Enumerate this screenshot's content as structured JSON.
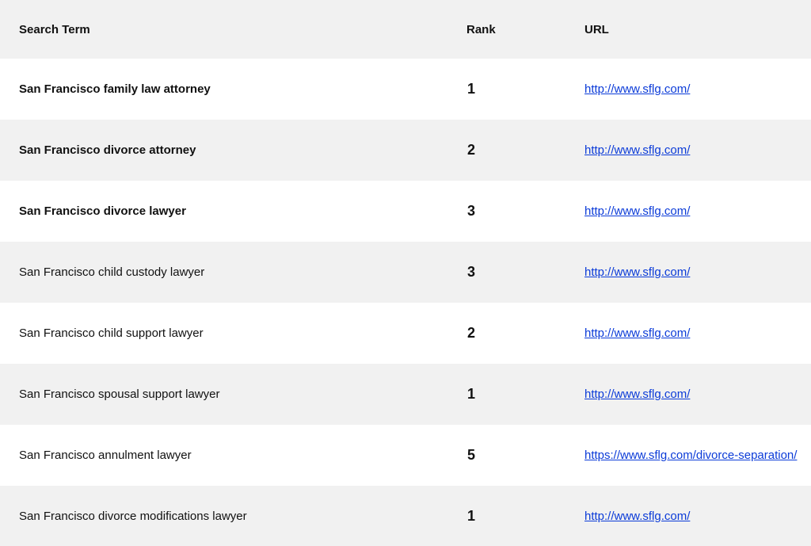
{
  "table": {
    "headers": {
      "search_term": "Search Term",
      "rank": "Rank",
      "url": "URL"
    },
    "rows": [
      {
        "term": "San Francisco family law attorney",
        "rank": "1",
        "url": "http://www.sflg.com/",
        "bold": true
      },
      {
        "term": "San Francisco divorce attorney",
        "rank": "2",
        "url": "http://www.sflg.com/",
        "bold": true
      },
      {
        "term": "San Francisco divorce lawyer",
        "rank": "3",
        "url": "http://www.sflg.com/",
        "bold": true
      },
      {
        "term": "San Francisco child custody lawyer",
        "rank": "3",
        "url": "http://www.sflg.com/",
        "bold": false
      },
      {
        "term": "San Francisco child support lawyer",
        "rank": "2",
        "url": "http://www.sflg.com/",
        "bold": false
      },
      {
        "term": "San Francisco spousal support lawyer",
        "rank": "1",
        "url": "http://www.sflg.com/",
        "bold": false
      },
      {
        "term": "San Francisco annulment lawyer",
        "rank": "5",
        "url": "https://www.sflg.com/divorce-separation/",
        "bold": false
      },
      {
        "term": "San Francisco divorce modifications lawyer",
        "rank": "1",
        "url": "http://www.sflg.com/",
        "bold": false
      }
    ]
  },
  "colors": {
    "stripe": "#f1f1f1",
    "link": "#0b3bd8"
  }
}
